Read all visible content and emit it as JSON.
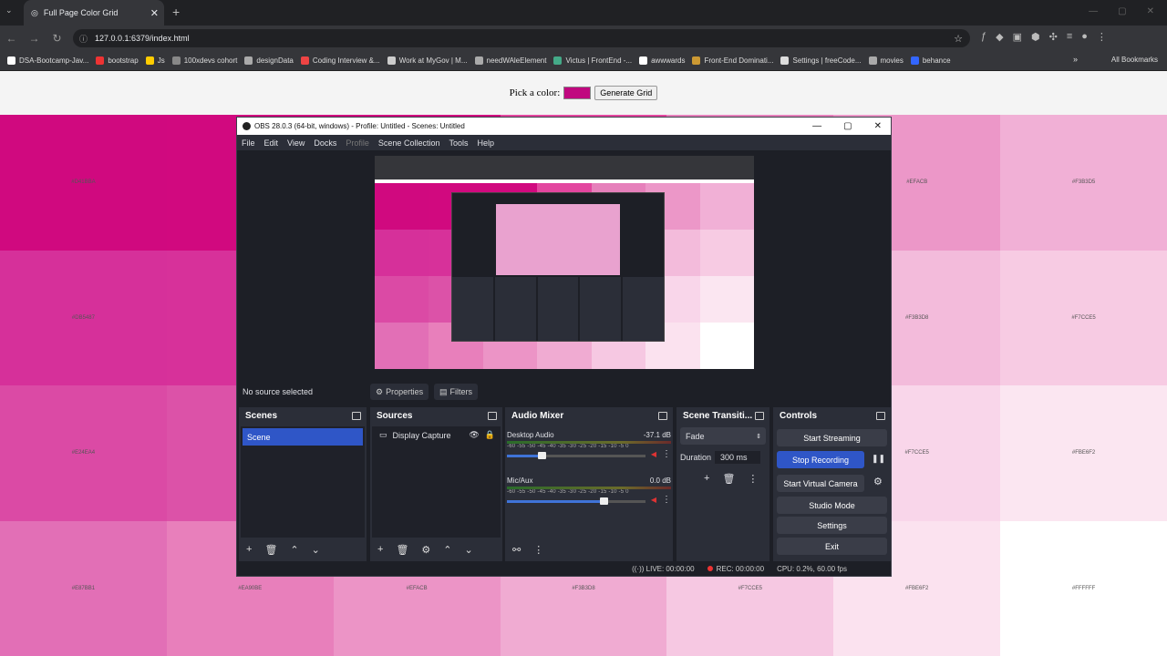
{
  "browser": {
    "tab_title": "Full Page Color Grid",
    "url": "127.0.0.1:6379/index.html",
    "bookmarks": [
      "DSA-Bootcamp-Jav...",
      "bootstrap",
      "Js",
      "100xdevs cohort",
      "designData",
      "Coding Interview &...",
      "Work at MyGov | M...",
      "needWAleElement",
      "Victus | FrontEnd -...",
      "awwwards",
      "Front-End Dominati...",
      "Settings | freeCode...",
      "movies",
      "behance"
    ],
    "all_bookmarks": "All Bookmarks"
  },
  "page": {
    "pick_label": "Pick a color:",
    "picked_color": "#c0087f",
    "generate_label": "Generate Grid",
    "grid": [
      [
        "#D41BBA",
        "",
        "",
        "",
        "",
        "#EFACB",
        "#F3B3D5"
      ],
      [
        "#DB5487",
        "",
        "",
        "",
        "",
        "#F3B3D8",
        "#F7CCE5"
      ],
      [
        "#E24EA4",
        "",
        "",
        "",
        "",
        "#F7CCE5",
        "#FBE6F2"
      ],
      [
        "#E87BB1",
        "#EA90BE",
        "#EFACB",
        "#F3B3D8",
        "#F7CCE5",
        "#FBE6F2",
        "#FFFFFF"
      ]
    ],
    "grid_colors": [
      [
        "#d0097f",
        "#d1097f",
        "#d1097f",
        "#e3469f",
        "#e680bb",
        "#ec97c8",
        "#f1b0d6"
      ],
      [
        "#d6309a",
        "#d7319a",
        "#d8369e",
        "#e65fae",
        "#f0aad4",
        "#f3bbdb",
        "#f7cbe3"
      ],
      [
        "#db4aa5",
        "#dc52a8",
        "#e063ad",
        "#eb86c2",
        "#f6c8e3",
        "#f9d6ea",
        "#fbe6f1"
      ],
      [
        "#e26fb6",
        "#e87fbb",
        "#ec94c6",
        "#f0abd2",
        "#f6c8e2",
        "#fbe2ef",
        "#ffffff"
      ]
    ]
  },
  "obs": {
    "title": "OBS 28.0.3 (64-bit, windows) - Profile: Untitled - Scenes: Untitled",
    "menu": [
      "File",
      "Edit",
      "View",
      "Docks",
      "Profile",
      "Scene Collection",
      "Tools",
      "Help"
    ],
    "no_source": "No source selected",
    "properties": "Properties",
    "filters": "Filters",
    "docks": {
      "scenes": "Scenes",
      "sources": "Sources",
      "mixer": "Audio Mixer",
      "transitions": "Scene Transiti...",
      "controls": "Controls"
    },
    "scene_item": "Scene",
    "source_item": "Display Capture",
    "audio": [
      {
        "name": "Desktop Audio",
        "db": "-37.1 dB",
        "level": 0.25
      },
      {
        "name": "Mic/Aux",
        "db": "0.0 dB",
        "level": 0.7
      }
    ],
    "ticks": "-60 -55 -50 -45 -40 -35 -30 -25 -20 -15 -10 -5 0",
    "transition": "Fade",
    "duration_label": "Duration",
    "duration_value": "300 ms",
    "controls": [
      "Start Streaming",
      "Stop Recording",
      "Start Virtual Camera",
      "Studio Mode",
      "Settings",
      "Exit"
    ],
    "status": {
      "live": "LIVE: 00:00:00",
      "rec": "REC: 00:00:00",
      "cpu": "CPU: 0.2%, 60.00 fps"
    }
  }
}
